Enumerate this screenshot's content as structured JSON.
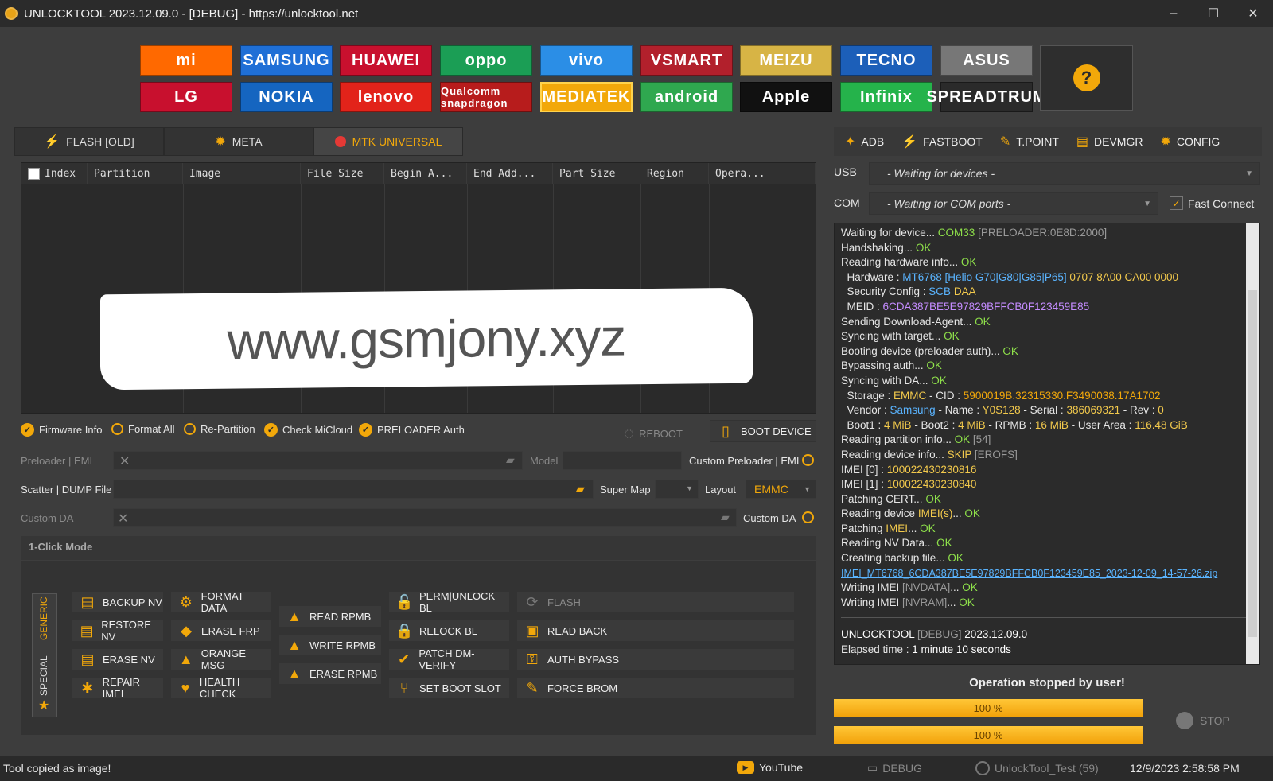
{
  "window": {
    "title": "UNLOCKTOOL 2023.12.09.0 - [DEBUG] - https://unlocktool.net",
    "minimize": "–",
    "maximize": "☐",
    "close": "✕"
  },
  "brands": {
    "row1": [
      {
        "label": "mi",
        "color": "#ff6900"
      },
      {
        "label": "SAMSUNG",
        "color": "#1f6fd6"
      },
      {
        "label": "HUAWEI",
        "color": "#c8102e"
      },
      {
        "label": "oppo",
        "color": "#1b9e55"
      },
      {
        "label": "vivo",
        "color": "#2b8ee6"
      },
      {
        "label": "VSMART",
        "color": "#b2202c"
      },
      {
        "label": "MEIZU",
        "color": "#d7b445"
      },
      {
        "label": "TECNO",
        "color": "#1c5fb9"
      },
      {
        "label": "ASUS",
        "color": "#777777"
      }
    ],
    "row2": [
      {
        "label": "LG",
        "color": "#c8102e"
      },
      {
        "label": "NOKIA",
        "color": "#1565c0"
      },
      {
        "label": "lenovo",
        "color": "#e2231a"
      },
      {
        "label": "Qualcomm snapdragon",
        "color": "#b71c1c"
      },
      {
        "label": "MEDIATEK",
        "color": "#f2a80a"
      },
      {
        "label": "android",
        "color": "#2fa84f"
      },
      {
        "label": "Apple",
        "color": "#111111"
      },
      {
        "label": "Infinix",
        "color": "#25b34b"
      },
      {
        "label": "SPREADTRUM",
        "color": "#2a2a2a"
      }
    ],
    "help": "?"
  },
  "tabs": [
    {
      "label": "FLASH [OLD]",
      "icon": "lightning-icon"
    },
    {
      "label": "META",
      "icon": "gear-icon"
    },
    {
      "label": "MTK UNIVERSAL",
      "icon": "red-dot-icon"
    }
  ],
  "right_tabs": [
    {
      "label": "ADB",
      "icon": "android-icon"
    },
    {
      "label": "FASTBOOT",
      "icon": "lightning-icon"
    },
    {
      "label": "T.POINT",
      "icon": "pin-icon"
    },
    {
      "label": "DEVMGR",
      "icon": "devmgr-icon"
    },
    {
      "label": "CONFIG",
      "icon": "gear-icon"
    }
  ],
  "grid": {
    "columns": [
      "Index",
      "Partition",
      "Image",
      "File Size",
      "Begin A...",
      "End Add...",
      "Part Size",
      "Region",
      "Opera..."
    ]
  },
  "watermark": "www.gsmjony.xyz",
  "options": {
    "firmware_info": "Firmware Info",
    "format_all": "Format All",
    "re_partition": "Re-Partition",
    "check_micloud": "Check MiCloud",
    "preloader_auth": "PRELOADER Auth",
    "reboot": "REBOOT",
    "boot_device": "BOOT DEVICE"
  },
  "fields": {
    "preloader_label": "Preloader | EMI",
    "model_label": "Model",
    "custom_preloader_label": "Custom Preloader | EMI",
    "scatter_label": "Scatter | DUMP File",
    "super_map_label": "Super Map",
    "layout_label": "Layout",
    "layout_value": "EMMC",
    "custom_da_left": "Custom DA",
    "custom_da_right": "Custom DA"
  },
  "one_click": {
    "title": "1-Click Mode",
    "side_tabs": [
      "GENERIC",
      "SPECIAL"
    ],
    "col1": [
      "BACKUP NV",
      "RESTORE NV",
      "ERASE NV",
      "REPAIR IMEI"
    ],
    "col2": [
      "FORMAT DATA",
      "ERASE FRP",
      "ORANGE MSG",
      "HEALTH CHECK"
    ],
    "col3": [
      "READ RPMB",
      "WRITE RPMB",
      "ERASE RPMB"
    ],
    "col4": [
      "PERM|UNLOCK BL",
      "RELOCK BL",
      "PATCH DM-VERIFY",
      "SET BOOT SLOT"
    ],
    "col5": [
      "FLASH",
      "READ BACK",
      "AUTH BYPASS",
      "FORCE BROM"
    ]
  },
  "conn": {
    "usb_label": "USB",
    "usb_value": "- Waiting for devices -",
    "com_label": "COM",
    "com_value": "- Waiting for COM ports -",
    "fast_connect": "Fast Connect"
  },
  "log": {
    "l1": [
      "Waiting for device... ",
      "COM33",
      " [PRELOADER:0E8D:2000]"
    ],
    "l2": [
      "Handshaking... ",
      "OK"
    ],
    "l3": [
      "Reading hardware info... ",
      "OK"
    ],
    "l4": [
      "  Hardware : ",
      "MT6768 [Helio G70|G80|G85|P65]",
      " 0707 8A00 CA00 0000"
    ],
    "l5": [
      "  Security Config : ",
      "SCB",
      " DAA"
    ],
    "l6": [
      "  MEID : ",
      "6CDA387BE5E97829BFFCB0F123459E85"
    ],
    "l7": [
      "Sending Download-Agent... ",
      "OK"
    ],
    "l8": [
      "Syncing with target... ",
      "OK"
    ],
    "l9": [
      "Booting device (preloader auth)... ",
      "OK"
    ],
    "l10": [
      "Bypassing auth... ",
      "OK"
    ],
    "l11": [
      "Syncing with DA... ",
      "OK"
    ],
    "l12": [
      "  Storage : ",
      "EMMC",
      " - CID : ",
      "5900019B.32315330.F3490038.17A1702"
    ],
    "l13": [
      "  Vendor : ",
      "Samsung",
      " - Name : ",
      "Y0S128",
      " - Serial : ",
      "386069321",
      " - Rev : ",
      "0"
    ],
    "l14": [
      "  Boot1 : ",
      "4 MiB",
      " - Boot2 : ",
      "4 MiB",
      " - RPMB : ",
      "16 MiB",
      " - User Area : ",
      "116.48 GiB"
    ],
    "l15": [
      "Reading partition info... ",
      "OK",
      " [54]"
    ],
    "l16": [
      "Reading device info... ",
      "SKIP",
      " [EROFS]"
    ],
    "l17": [
      "IMEI [0] : ",
      "100022430230816"
    ],
    "l18": [
      "IMEI [1] : ",
      "100022430230840"
    ],
    "l19": [
      "Patching CERT... ",
      "OK"
    ],
    "l20": [
      "Reading device ",
      "IMEI(s)",
      "... ",
      "OK"
    ],
    "l21": [
      "Patching ",
      "IMEI",
      "... ",
      "OK"
    ],
    "l22": [
      "Reading NV Data... ",
      "OK"
    ],
    "l23": [
      "Creating backup file... ",
      "OK"
    ],
    "l24": "IMEI_MT6768_6CDA387BE5E97829BFFCB0F123459E85_2023-12-09_14-57-26.zip",
    "l25": [
      "Writing IMEI ",
      "[NVDATA]",
      "... ",
      "OK"
    ],
    "l26": [
      "Writing IMEI ",
      "[NVRAM]",
      "... ",
      "OK"
    ],
    "f1": [
      "UNLOCKTOOL ",
      "[DEBUG]",
      " 2023.12.09.0"
    ],
    "f2": [
      "Elapsed time : ",
      "1 minute 10 seconds"
    ]
  },
  "progress": {
    "message": "Operation stopped by user!",
    "bar1": "100 %",
    "bar2": "100 %",
    "value1": 100,
    "value2": 100,
    "stop": "STOP"
  },
  "status": {
    "left": "Tool copied as image!",
    "youtube": "YouTube",
    "debug": "DEBUG",
    "user": "UnlockTool_Test (59)",
    "datetime": "12/9/2023 2:58:58 PM"
  }
}
